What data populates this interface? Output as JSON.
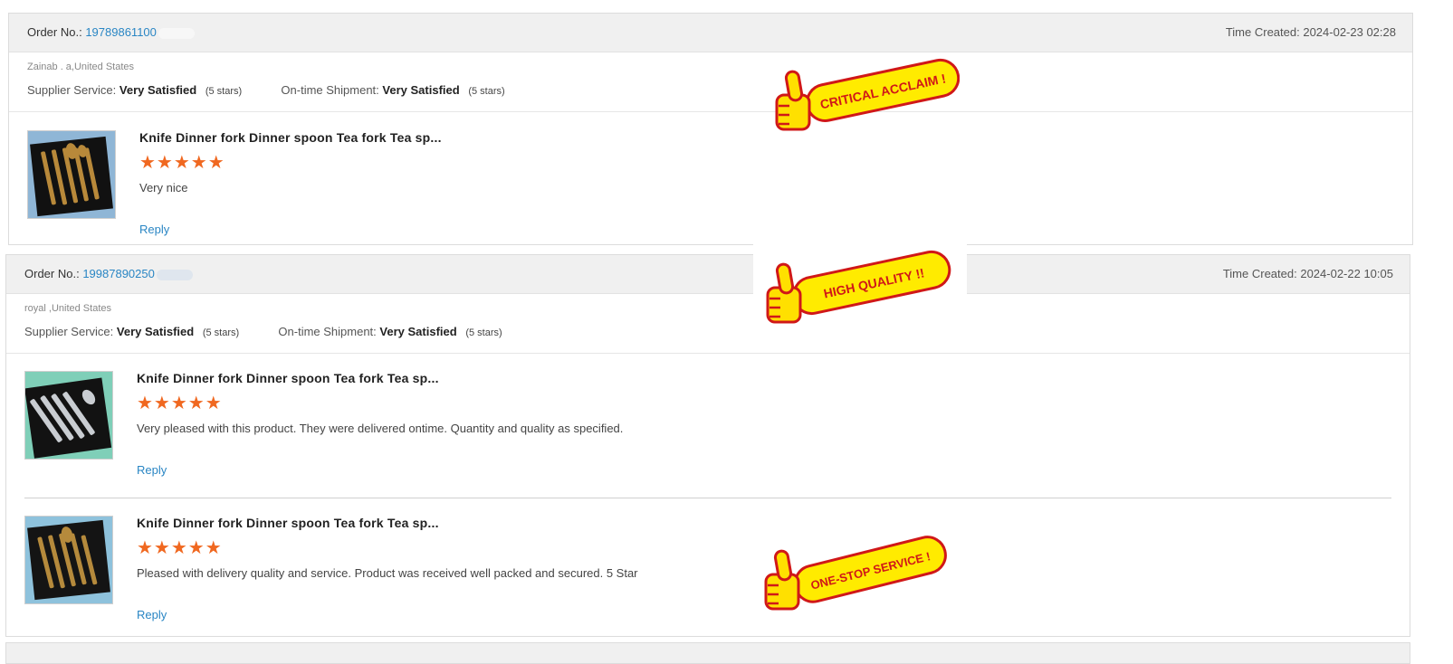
{
  "labels": {
    "order_no": "Order No.:",
    "time_created": "Time Created:",
    "supplier_service": "Supplier Service:",
    "ontime_shipment": "On-time Shipment:",
    "reply": "Reply"
  },
  "orders": [
    {
      "order_number": "19789861100",
      "time_created": "2024-02-23 02:28",
      "buyer": "Zainab .         a,United States",
      "supplier_service": "Very Satisfied",
      "supplier_stars": "(5 stars)",
      "shipment": "Very Satisfied",
      "shipment_stars": "(5 stars)",
      "items": [
        {
          "title": "Knife Dinner fork Dinner spoon Tea fork Tea sp...",
          "rating": 5,
          "stars": "★★★★★",
          "comment": "Very nice",
          "thumb_tone": "gold"
        }
      ]
    },
    {
      "order_number": "19987890250",
      "time_created": "2024-02-22 10:05",
      "buyer": "royal         ,United States",
      "supplier_service": "Very Satisfied",
      "supplier_stars": "(5 stars)",
      "shipment": "Very Satisfied",
      "shipment_stars": "(5 stars)",
      "items": [
        {
          "title": "Knife Dinner fork Dinner spoon Tea fork Tea sp...",
          "rating": 5,
          "stars": "★★★★★",
          "comment": "Very pleased with this product. They were delivered ontime. Quantity and quality as specified.",
          "thumb_tone": "silver"
        },
        {
          "title": "Knife Dinner fork Dinner spoon Tea fork Tea sp...",
          "rating": 5,
          "stars": "★★★★★",
          "comment": "Pleased with delivery quality and service. Product was received well packed and secured. 5 Star",
          "thumb_tone": "gold"
        }
      ]
    }
  ],
  "badges": [
    {
      "text": "CRITICAL ACCLAIM !",
      "icon": "thumbs-up-icon"
    },
    {
      "text": "HIGH QUALITY !!",
      "icon": "thumbs-up-icon"
    },
    {
      "text": "ONE-STOP SERVICE !",
      "icon": "thumbs-up-icon"
    }
  ],
  "colors": {
    "link": "#2a86c4",
    "star": "#f06820",
    "header_bg": "#f0f0f0",
    "badge_fill": "#ffeb00",
    "badge_text": "#d01818"
  }
}
